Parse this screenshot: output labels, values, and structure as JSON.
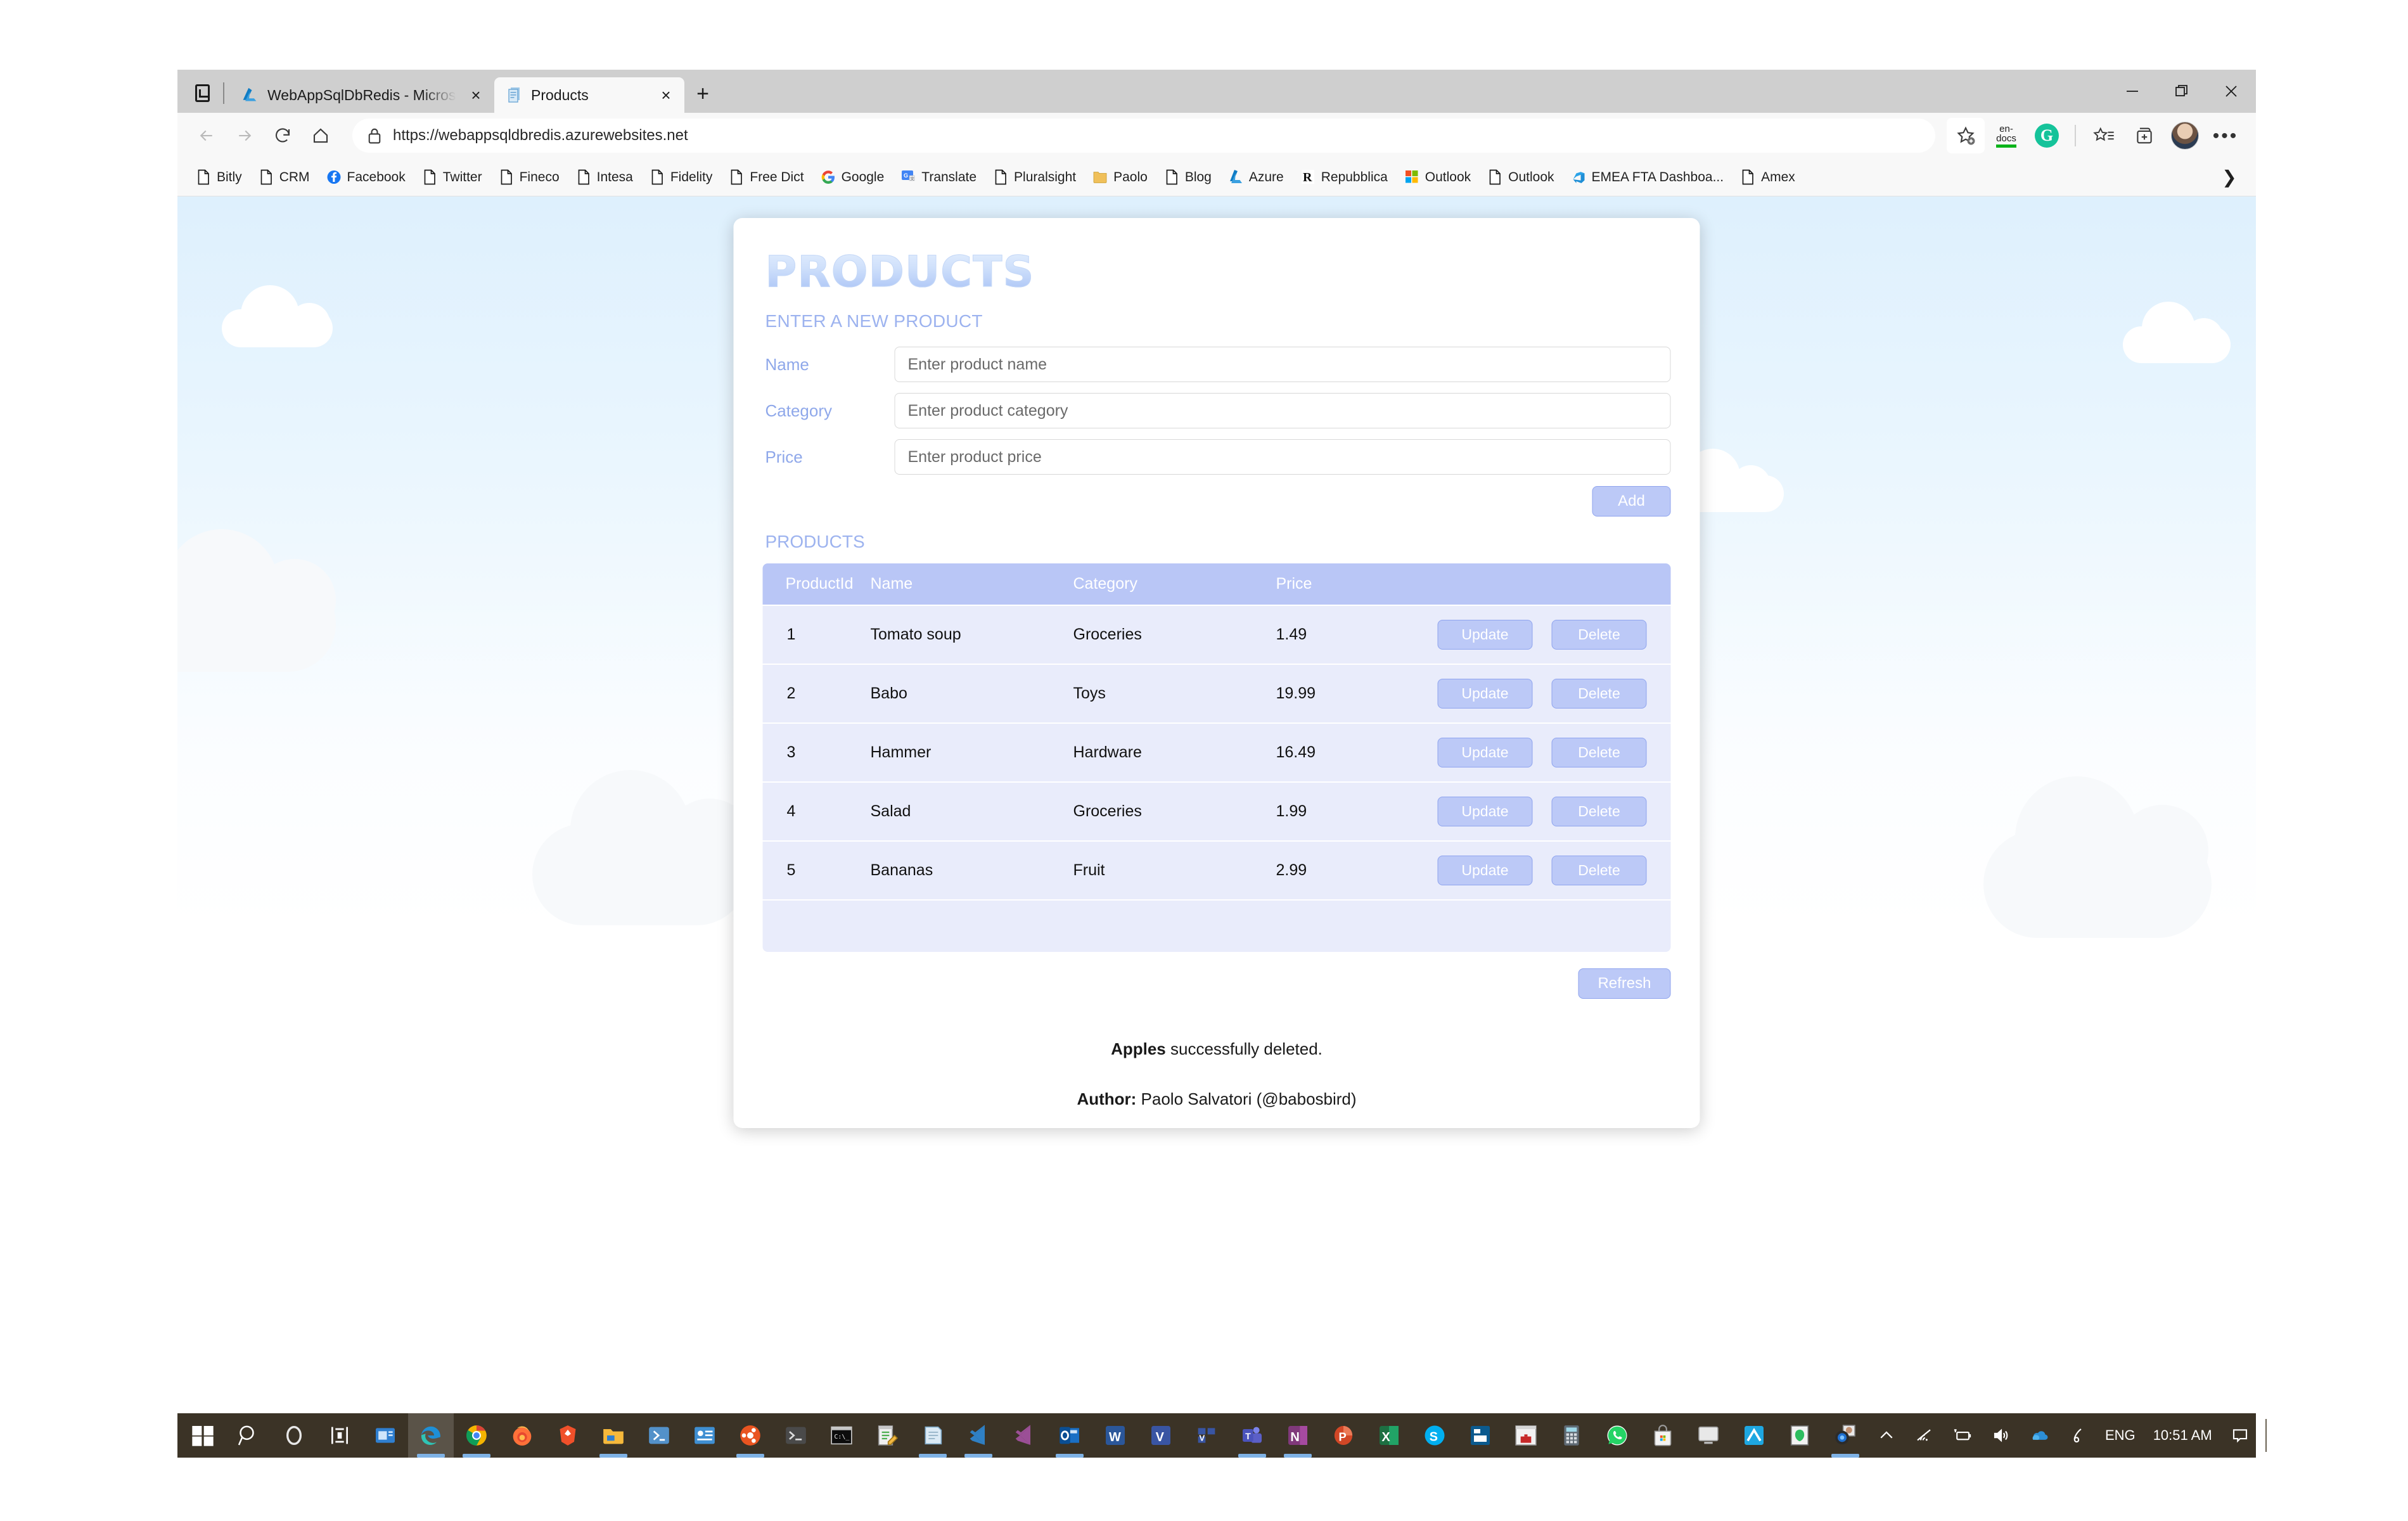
{
  "browser": {
    "tabs": [
      {
        "title": "WebAppSqlDbRedis - Microsoft A",
        "favicon": "azure-icon",
        "active": false
      },
      {
        "title": "Products",
        "favicon": "document-icon",
        "active": true
      }
    ],
    "new_tab_label": "+",
    "tab_close_label": "×",
    "window_controls": {
      "minimize": "minimize-icon",
      "maximize": "maximize-icon",
      "close": "close-icon"
    },
    "nav": {
      "back": "back-arrow-icon",
      "forward": "forward-arrow-icon",
      "refresh": "reload-icon",
      "home": "home-icon"
    },
    "omnibox": {
      "lock": "lock-icon",
      "url": "https://webappsqldbredis.azurewebsites.net"
    },
    "toolbar": {
      "add_favorite": "star-plus-icon",
      "endocs_line1": "en-",
      "endocs_line2": "docs",
      "grammarly": "G",
      "favorites": "favorites-star-list-icon",
      "collections": "collections-plus-icon",
      "profile": "profile-avatar",
      "settings_more": "•••"
    },
    "bookmarks": [
      {
        "label": "Bitly",
        "icon": "document-icon"
      },
      {
        "label": "CRM",
        "icon": "document-icon"
      },
      {
        "label": "Facebook",
        "icon": "facebook-icon"
      },
      {
        "label": "Twitter",
        "icon": "document-icon"
      },
      {
        "label": "Fineco",
        "icon": "document-icon"
      },
      {
        "label": "Intesa",
        "icon": "document-icon"
      },
      {
        "label": "Fidelity",
        "icon": "document-icon"
      },
      {
        "label": "Free Dict",
        "icon": "document-icon"
      },
      {
        "label": "Google",
        "icon": "google-icon"
      },
      {
        "label": "Translate",
        "icon": "google-translate-icon"
      },
      {
        "label": "Pluralsight",
        "icon": "document-icon"
      },
      {
        "label": "Paolo",
        "icon": "folder-icon"
      },
      {
        "label": "Blog",
        "icon": "document-icon"
      },
      {
        "label": "Azure",
        "icon": "azure-icon"
      },
      {
        "label": "Repubblica",
        "icon": "repubblica-icon"
      },
      {
        "label": "Outlook",
        "icon": "microsoft-icon"
      },
      {
        "label": "Outlook",
        "icon": "document-icon"
      },
      {
        "label": "EMEA FTA Dashboa...",
        "icon": "azure-devops-icon"
      },
      {
        "label": "Amex",
        "icon": "document-icon"
      }
    ],
    "bookmarks_overflow": "❯"
  },
  "page": {
    "title": "PRODUCTS",
    "form": {
      "heading": "ENTER A NEW PRODUCT",
      "fields": [
        {
          "label": "Name",
          "value": "",
          "placeholder": "Enter product name"
        },
        {
          "label": "Category",
          "value": "",
          "placeholder": "Enter product category"
        },
        {
          "label": "Price",
          "value": "",
          "placeholder": "Enter product price"
        }
      ],
      "add_label": "Add"
    },
    "table": {
      "heading": "PRODUCTS",
      "columns": [
        "ProductId",
        "Name",
        "Category",
        "Price",
        ""
      ],
      "rows": [
        {
          "id": "1",
          "name": "Tomato soup",
          "category": "Groceries",
          "price": "1.49",
          "update": "Update",
          "delete": "Delete"
        },
        {
          "id": "2",
          "name": "Babo",
          "category": "Toys",
          "price": "19.99",
          "update": "Update",
          "delete": "Delete"
        },
        {
          "id": "3",
          "name": "Hammer",
          "category": "Hardware",
          "price": "16.49",
          "update": "Update",
          "delete": "Delete"
        },
        {
          "id": "4",
          "name": "Salad",
          "category": "Groceries",
          "price": "1.99",
          "update": "Update",
          "delete": "Delete"
        },
        {
          "id": "5",
          "name": "Bananas",
          "category": "Fruit",
          "price": "2.99",
          "update": "Update",
          "delete": "Delete"
        }
      ]
    },
    "refresh_label": "Refresh",
    "status_message": {
      "bold": "Apples",
      "rest": " successfully deleted."
    },
    "author": {
      "label": "Author:",
      "name": " Paolo Salvatori (@babosbird)"
    },
    "colors": {
      "accent": "#b9c6f6",
      "row_bg": "#e9ecfb",
      "label_blue": "#8fa8ea",
      "heading_blue": "#9db3ef"
    }
  },
  "taskbar": {
    "start": "windows-start-icon",
    "search": "search-icon",
    "cortana": "cortana-circle-icon",
    "task_view": "task-view-icon",
    "apps": [
      "news-icon",
      "edge-icon",
      "chrome-icon",
      "firefox-icon",
      "brave-icon",
      "file-explorer-icon",
      "powershell-icon",
      "azure-data-studio-icon",
      "sql-server-management-studio-icon",
      "ubuntu-icon",
      "terminal-icon",
      "command-prompt-icon",
      "notepadpp-icon",
      "notepad-icon",
      "vscode-icon",
      "visual-studio-icon",
      "outlook-icon",
      "word-icon",
      "visio-icon",
      "visio2-icon",
      "teams-icon",
      "onenote-icon",
      "powerpoint-icon",
      "excel-icon",
      "skype-icon",
      "publisher-icon",
      "toolbox-icon",
      "calculator-icon",
      "whatsapp-icon",
      "store-icon",
      "remote-desktop-icon",
      "onenote2-icon",
      "evernote-icon",
      "camera-photo-icon"
    ],
    "tray": {
      "show_hidden": "chevron-up-icon",
      "wifi": "wifi-icon",
      "battery": "battery-charging-icon",
      "volume": "volume-icon",
      "onedrive": "onedrive-icon",
      "pen": "pen-icon",
      "language": "ENG",
      "clock": "10:51 AM",
      "action_center": "action-center-icon"
    }
  }
}
